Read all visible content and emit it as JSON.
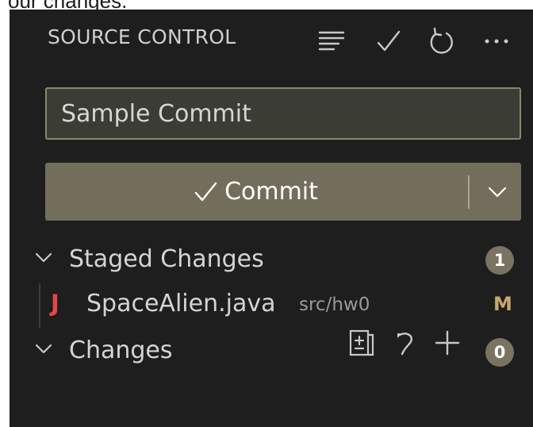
{
  "page": {
    "caption": "our changes."
  },
  "header": {
    "title": "SOURCE CONTROL",
    "actions": [
      "view-as-list-icon",
      "commit-check-icon",
      "refresh-icon",
      "more-actions-icon"
    ]
  },
  "commit": {
    "message": "Sample Commit",
    "button_label": "Commit",
    "button_icon": "check-icon",
    "dropdown_icon": "chevron-down-icon"
  },
  "staged": {
    "label": "Staged Changes",
    "count": "1",
    "files": [
      {
        "icon_letter": "J",
        "name": "SpaceAlien.java",
        "path": "src/hw0",
        "status": "M"
      }
    ]
  },
  "changes": {
    "label": "Changes",
    "count": "0",
    "actions": [
      "open-changes-icon",
      "discard-icon",
      "stage-all-icon"
    ]
  },
  "colors": {
    "panel_bg": "#1e1e1e",
    "input_bg": "#3b3c34",
    "input_border": "#8c8769",
    "button_bg": "#736d5c",
    "badge_bg": "#7a7362",
    "java_red": "#e5474b",
    "modified": "#c9a76b"
  }
}
